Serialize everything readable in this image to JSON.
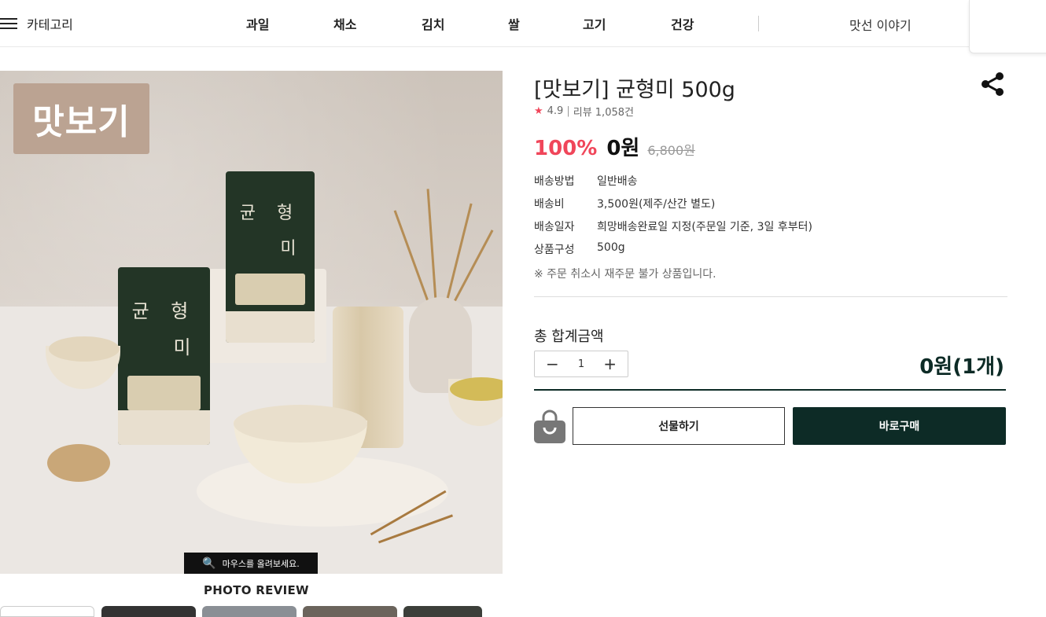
{
  "header": {
    "category_label": "카테고리",
    "nav": [
      "과일",
      "채소",
      "김치",
      "쌀",
      "고기",
      "건강"
    ],
    "story_label": "맛선 이야기"
  },
  "gallery": {
    "badge": "맛보기",
    "bag_title": "균 형",
    "bag_title2": "미",
    "hover_hint": "마우스를 올려보세요.",
    "photo_review": "PHOTO REVIEW"
  },
  "product": {
    "title": "[맛보기] 균형미 500g",
    "rating": "4.9",
    "review_label": "리뷰 1,058건",
    "discount": "100%",
    "sale_price": "0원",
    "original_price": "6,800원",
    "specs": [
      {
        "label": "배송방법",
        "value": "일반배송"
      },
      {
        "label": "배송비",
        "value": "3,500원(제주/산간 별도)"
      },
      {
        "label": "배송일자",
        "value": "희망배송완료일 지정(주문일 기준, 3일 후부터)"
      },
      {
        "label": "상품구성",
        "value": "500g"
      }
    ],
    "note": "※ 주문 취소시 재주문 불가 상품입니다."
  },
  "order": {
    "total_label": "총 합계금액",
    "quantity": "1",
    "total_amount": "0원(1개)",
    "gift_label": "선물하기",
    "buy_label": "바로구매"
  },
  "colors": {
    "accent": "#f0465a",
    "brand": "#0d2b26"
  }
}
